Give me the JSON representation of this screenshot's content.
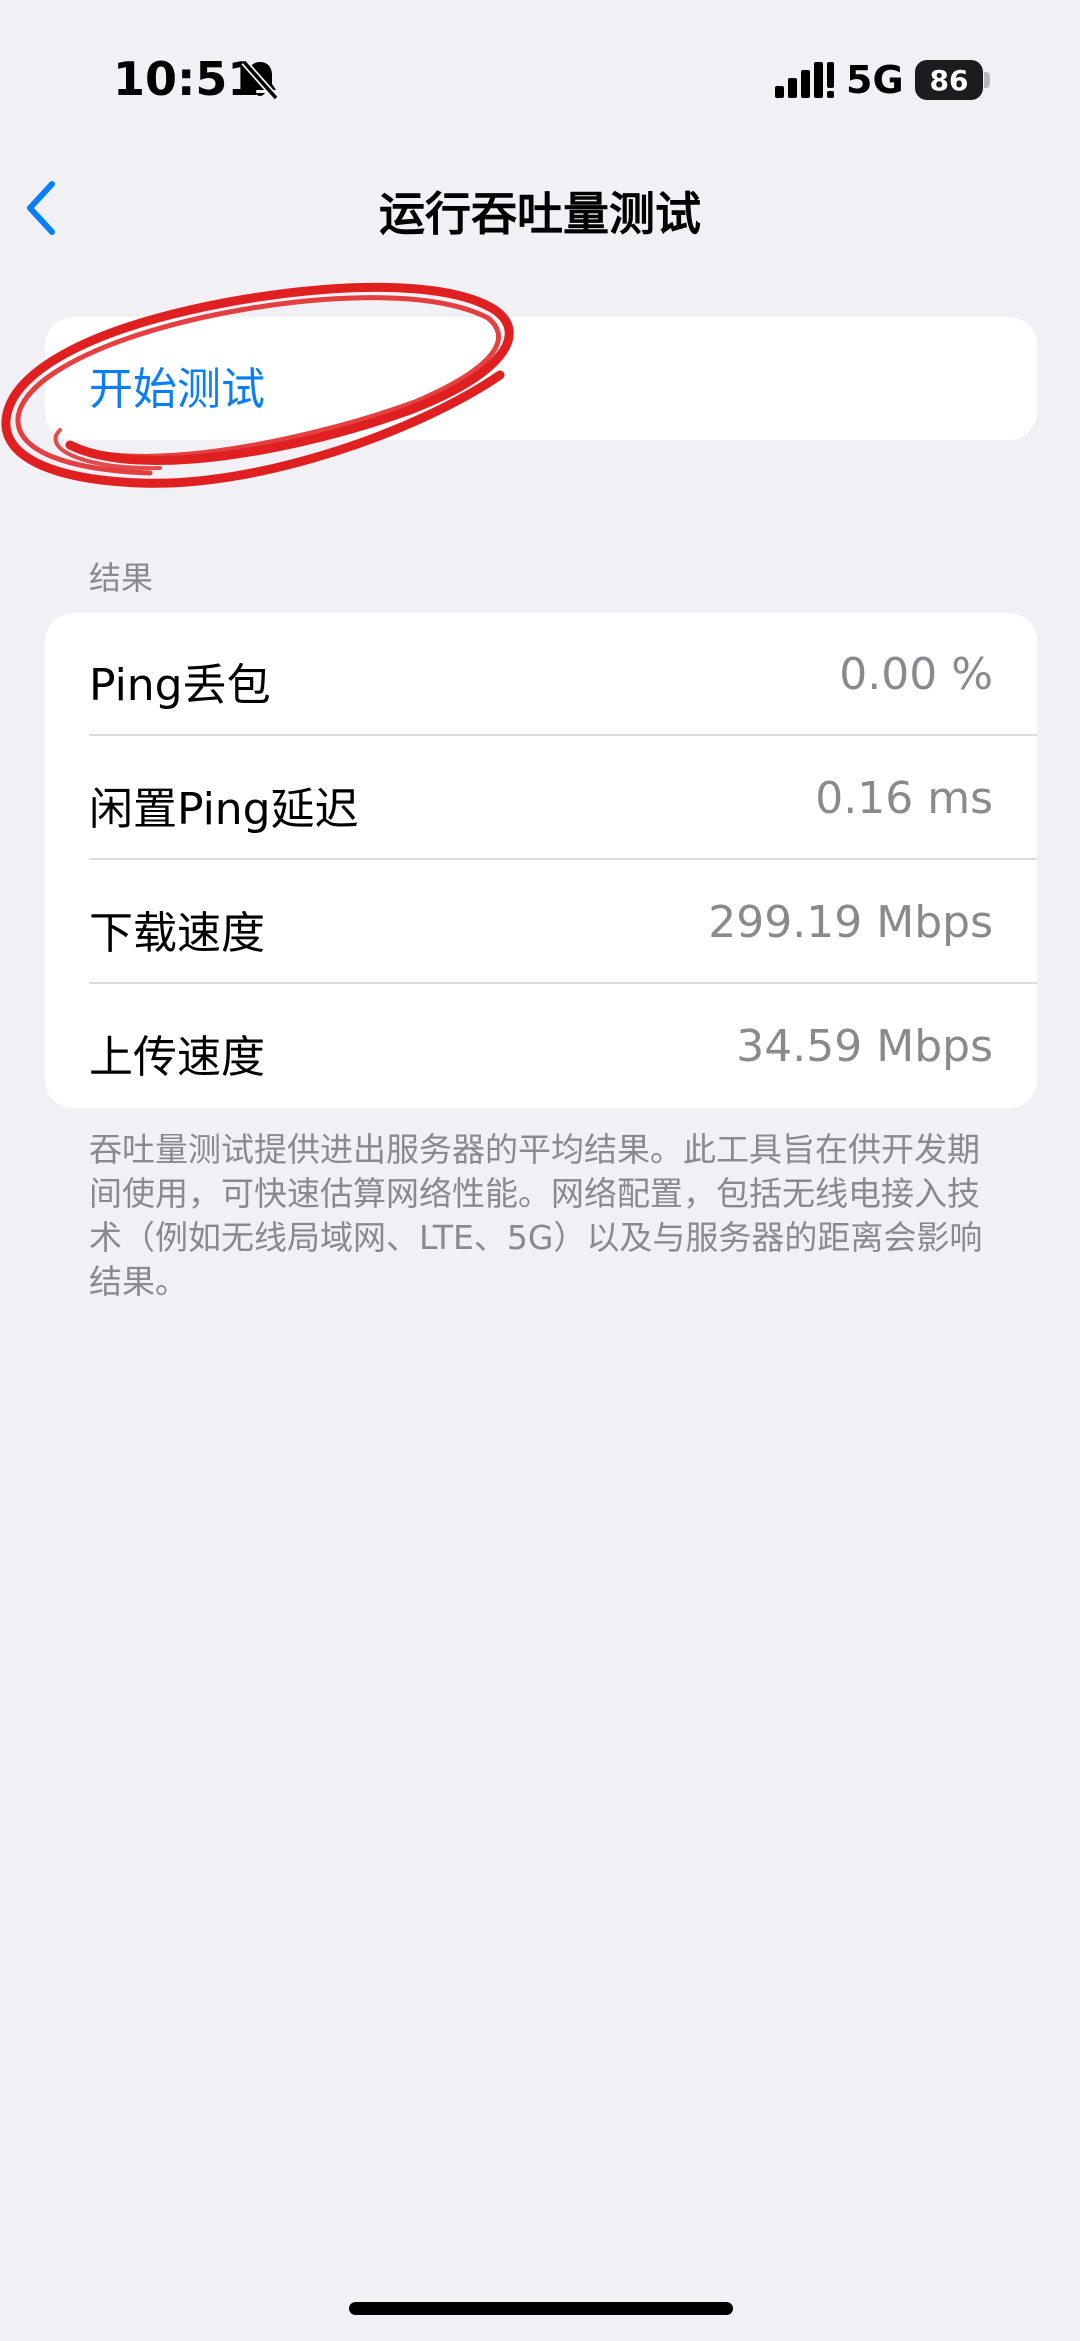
{
  "status_bar": {
    "time": "10:51",
    "bell_icon": "bell-slash-icon",
    "signal_icon": "cellular-signal-icon",
    "network": "5G",
    "battery": "86"
  },
  "nav": {
    "back_icon": "chevron-left-icon",
    "title": "运行吞吐量测试"
  },
  "start_test": {
    "label": "开始测试",
    "annotation_color": "#e02020"
  },
  "results": {
    "header": "结果",
    "rows": [
      {
        "label": "Ping丢包",
        "value": "0.00 %"
      },
      {
        "label": "闲置Ping延迟",
        "value": "0.16 ms"
      },
      {
        "label": "下载速度",
        "value": "299.19 Mbps"
      },
      {
        "label": "上传速度",
        "value": "34.59 Mbps"
      }
    ]
  },
  "footnote": "吞吐量测试提供进出服务器的平均结果。此工具旨在供开发期间使用，可快速估算网络性能。网络配置，包括无线电接入技术（例如无线局域网、LTE、5G）以及与服务器的距离会影响结果。",
  "colors": {
    "accent": "#0a7ff5",
    "background": "#f0f0f5",
    "secondary_text": "#8a8a8e"
  }
}
